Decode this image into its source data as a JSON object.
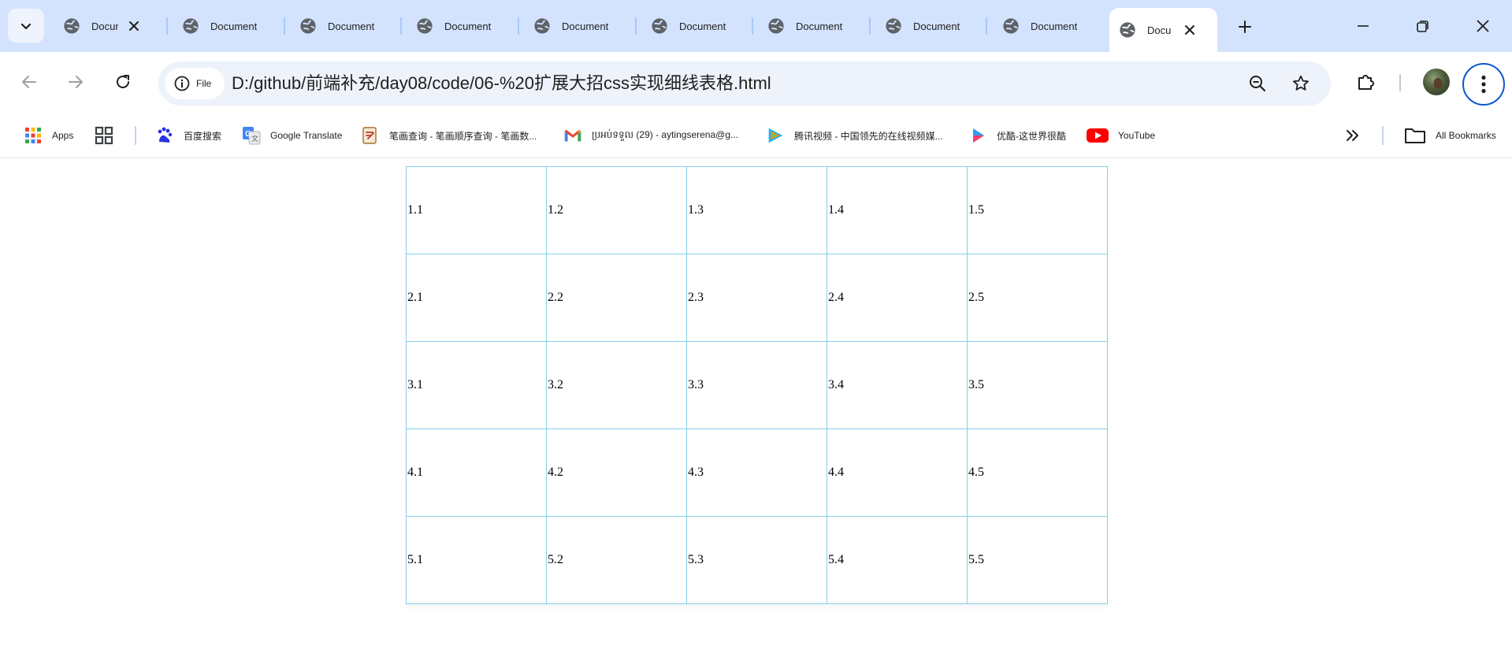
{
  "tabs": [
    {
      "title": "Docum",
      "active": false,
      "closable": true
    },
    {
      "title": "Document",
      "active": false
    },
    {
      "title": "Document",
      "active": false
    },
    {
      "title": "Document",
      "active": false
    },
    {
      "title": "Document",
      "active": false
    },
    {
      "title": "Document",
      "active": false
    },
    {
      "title": "Document",
      "active": false
    },
    {
      "title": "Document",
      "active": false
    },
    {
      "title": "Document",
      "active": false
    },
    {
      "title": "Docu",
      "active": true,
      "closable": true
    }
  ],
  "toolbar": {
    "site_chip_label": "File",
    "url": "D:/github/前端补充/day08/code/06-%20扩展大招css实现细线表格.html"
  },
  "bookmarks": {
    "apps": "Apps",
    "items": [
      {
        "label": "百度搜索",
        "icon": "baidu-icon"
      },
      {
        "label": "Google Translate",
        "icon": "google-translate-icon"
      },
      {
        "label": "笔画查询 - 笔画顺序查询 - 笔画数...",
        "icon": "stroke-order-icon"
      },
      {
        "label": "ប្រអប់ទទួល (29) - aytingserena@g...",
        "icon": "gmail-icon"
      },
      {
        "label": "腾讯视频 - 中国领先的在线视频媒...",
        "icon": "tencent-video-icon"
      },
      {
        "label": "优酷-这世界很酷",
        "icon": "youku-icon"
      },
      {
        "label": "YouTube",
        "icon": "youtube-icon"
      }
    ],
    "all_bookmarks": "All Bookmarks"
  },
  "table": {
    "rows": [
      [
        "1.1",
        "1.2",
        "1.3",
        "1.4",
        "1.5"
      ],
      [
        "2.1",
        "2.2",
        "2.3",
        "2.4",
        "2.5"
      ],
      [
        "3.1",
        "3.2",
        "3.3",
        "3.4",
        "3.5"
      ],
      [
        "4.1",
        "4.2",
        "4.3",
        "4.4",
        "4.5"
      ],
      [
        "5.1",
        "5.2",
        "5.3",
        "5.4",
        "5.5"
      ]
    ],
    "border_color": "#87ceeb"
  },
  "colors": {
    "tabstrip": "#d3e3fd",
    "omnibox": "#eef2fa",
    "focus_ring": "#0b57d0"
  }
}
